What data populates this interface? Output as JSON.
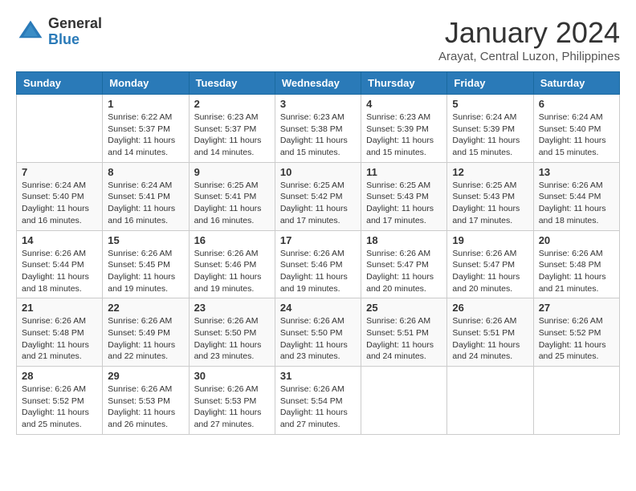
{
  "header": {
    "logo": {
      "general": "General",
      "blue": "Blue"
    },
    "title": "January 2024",
    "subtitle": "Arayat, Central Luzon, Philippines"
  },
  "days_of_week": [
    "Sunday",
    "Monday",
    "Tuesday",
    "Wednesday",
    "Thursday",
    "Friday",
    "Saturday"
  ],
  "weeks": [
    [
      {
        "day": "",
        "sunrise": "",
        "sunset": "",
        "daylight": ""
      },
      {
        "day": "1",
        "sunrise": "Sunrise: 6:22 AM",
        "sunset": "Sunset: 5:37 PM",
        "daylight": "Daylight: 11 hours and 14 minutes."
      },
      {
        "day": "2",
        "sunrise": "Sunrise: 6:23 AM",
        "sunset": "Sunset: 5:37 PM",
        "daylight": "Daylight: 11 hours and 14 minutes."
      },
      {
        "day": "3",
        "sunrise": "Sunrise: 6:23 AM",
        "sunset": "Sunset: 5:38 PM",
        "daylight": "Daylight: 11 hours and 15 minutes."
      },
      {
        "day": "4",
        "sunrise": "Sunrise: 6:23 AM",
        "sunset": "Sunset: 5:39 PM",
        "daylight": "Daylight: 11 hours and 15 minutes."
      },
      {
        "day": "5",
        "sunrise": "Sunrise: 6:24 AM",
        "sunset": "Sunset: 5:39 PM",
        "daylight": "Daylight: 11 hours and 15 minutes."
      },
      {
        "day": "6",
        "sunrise": "Sunrise: 6:24 AM",
        "sunset": "Sunset: 5:40 PM",
        "daylight": "Daylight: 11 hours and 15 minutes."
      }
    ],
    [
      {
        "day": "7",
        "sunrise": "Sunrise: 6:24 AM",
        "sunset": "Sunset: 5:40 PM",
        "daylight": "Daylight: 11 hours and 16 minutes."
      },
      {
        "day": "8",
        "sunrise": "Sunrise: 6:24 AM",
        "sunset": "Sunset: 5:41 PM",
        "daylight": "Daylight: 11 hours and 16 minutes."
      },
      {
        "day": "9",
        "sunrise": "Sunrise: 6:25 AM",
        "sunset": "Sunset: 5:41 PM",
        "daylight": "Daylight: 11 hours and 16 minutes."
      },
      {
        "day": "10",
        "sunrise": "Sunrise: 6:25 AM",
        "sunset": "Sunset: 5:42 PM",
        "daylight": "Daylight: 11 hours and 17 minutes."
      },
      {
        "day": "11",
        "sunrise": "Sunrise: 6:25 AM",
        "sunset": "Sunset: 5:43 PM",
        "daylight": "Daylight: 11 hours and 17 minutes."
      },
      {
        "day": "12",
        "sunrise": "Sunrise: 6:25 AM",
        "sunset": "Sunset: 5:43 PM",
        "daylight": "Daylight: 11 hours and 17 minutes."
      },
      {
        "day": "13",
        "sunrise": "Sunrise: 6:26 AM",
        "sunset": "Sunset: 5:44 PM",
        "daylight": "Daylight: 11 hours and 18 minutes."
      }
    ],
    [
      {
        "day": "14",
        "sunrise": "Sunrise: 6:26 AM",
        "sunset": "Sunset: 5:44 PM",
        "daylight": "Daylight: 11 hours and 18 minutes."
      },
      {
        "day": "15",
        "sunrise": "Sunrise: 6:26 AM",
        "sunset": "Sunset: 5:45 PM",
        "daylight": "Daylight: 11 hours and 19 minutes."
      },
      {
        "day": "16",
        "sunrise": "Sunrise: 6:26 AM",
        "sunset": "Sunset: 5:46 PM",
        "daylight": "Daylight: 11 hours and 19 minutes."
      },
      {
        "day": "17",
        "sunrise": "Sunrise: 6:26 AM",
        "sunset": "Sunset: 5:46 PM",
        "daylight": "Daylight: 11 hours and 19 minutes."
      },
      {
        "day": "18",
        "sunrise": "Sunrise: 6:26 AM",
        "sunset": "Sunset: 5:47 PM",
        "daylight": "Daylight: 11 hours and 20 minutes."
      },
      {
        "day": "19",
        "sunrise": "Sunrise: 6:26 AM",
        "sunset": "Sunset: 5:47 PM",
        "daylight": "Daylight: 11 hours and 20 minutes."
      },
      {
        "day": "20",
        "sunrise": "Sunrise: 6:26 AM",
        "sunset": "Sunset: 5:48 PM",
        "daylight": "Daylight: 11 hours and 21 minutes."
      }
    ],
    [
      {
        "day": "21",
        "sunrise": "Sunrise: 6:26 AM",
        "sunset": "Sunset: 5:48 PM",
        "daylight": "Daylight: 11 hours and 21 minutes."
      },
      {
        "day": "22",
        "sunrise": "Sunrise: 6:26 AM",
        "sunset": "Sunset: 5:49 PM",
        "daylight": "Daylight: 11 hours and 22 minutes."
      },
      {
        "day": "23",
        "sunrise": "Sunrise: 6:26 AM",
        "sunset": "Sunset: 5:50 PM",
        "daylight": "Daylight: 11 hours and 23 minutes."
      },
      {
        "day": "24",
        "sunrise": "Sunrise: 6:26 AM",
        "sunset": "Sunset: 5:50 PM",
        "daylight": "Daylight: 11 hours and 23 minutes."
      },
      {
        "day": "25",
        "sunrise": "Sunrise: 6:26 AM",
        "sunset": "Sunset: 5:51 PM",
        "daylight": "Daylight: 11 hours and 24 minutes."
      },
      {
        "day": "26",
        "sunrise": "Sunrise: 6:26 AM",
        "sunset": "Sunset: 5:51 PM",
        "daylight": "Daylight: 11 hours and 24 minutes."
      },
      {
        "day": "27",
        "sunrise": "Sunrise: 6:26 AM",
        "sunset": "Sunset: 5:52 PM",
        "daylight": "Daylight: 11 hours and 25 minutes."
      }
    ],
    [
      {
        "day": "28",
        "sunrise": "Sunrise: 6:26 AM",
        "sunset": "Sunset: 5:52 PM",
        "daylight": "Daylight: 11 hours and 25 minutes."
      },
      {
        "day": "29",
        "sunrise": "Sunrise: 6:26 AM",
        "sunset": "Sunset: 5:53 PM",
        "daylight": "Daylight: 11 hours and 26 minutes."
      },
      {
        "day": "30",
        "sunrise": "Sunrise: 6:26 AM",
        "sunset": "Sunset: 5:53 PM",
        "daylight": "Daylight: 11 hours and 27 minutes."
      },
      {
        "day": "31",
        "sunrise": "Sunrise: 6:26 AM",
        "sunset": "Sunset: 5:54 PM",
        "daylight": "Daylight: 11 hours and 27 minutes."
      },
      {
        "day": "",
        "sunrise": "",
        "sunset": "",
        "daylight": ""
      },
      {
        "day": "",
        "sunrise": "",
        "sunset": "",
        "daylight": ""
      },
      {
        "day": "",
        "sunrise": "",
        "sunset": "",
        "daylight": ""
      }
    ]
  ]
}
